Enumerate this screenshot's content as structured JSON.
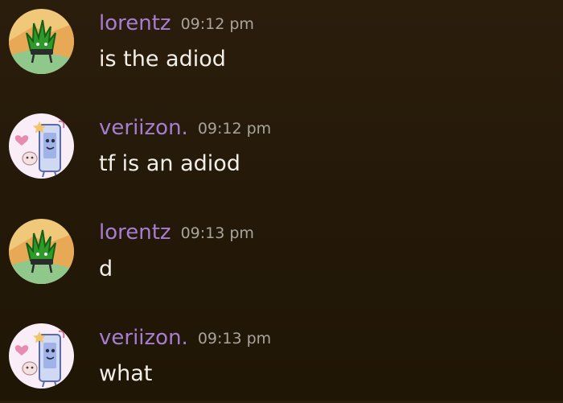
{
  "messages": [
    {
      "author": "lorentz",
      "time": "09:12 pm",
      "text": "is the adiod",
      "avatar": "fire-character-avatar"
    },
    {
      "author": "veriizon.",
      "time": "09:12 pm",
      "text": "tf is an adiod",
      "avatar": "phone-character-avatar"
    },
    {
      "author": "lorentz",
      "time": "09:13 pm",
      "text": "d",
      "avatar": "fire-character-avatar"
    },
    {
      "author": "veriizon.",
      "time": "09:13 pm",
      "text": "what",
      "avatar": "phone-character-avatar"
    }
  ],
  "colors": {
    "background": "#261a0a",
    "username": "#a77dd1",
    "timestamp": "#a8a49c",
    "message_text": "#f2efe9"
  }
}
